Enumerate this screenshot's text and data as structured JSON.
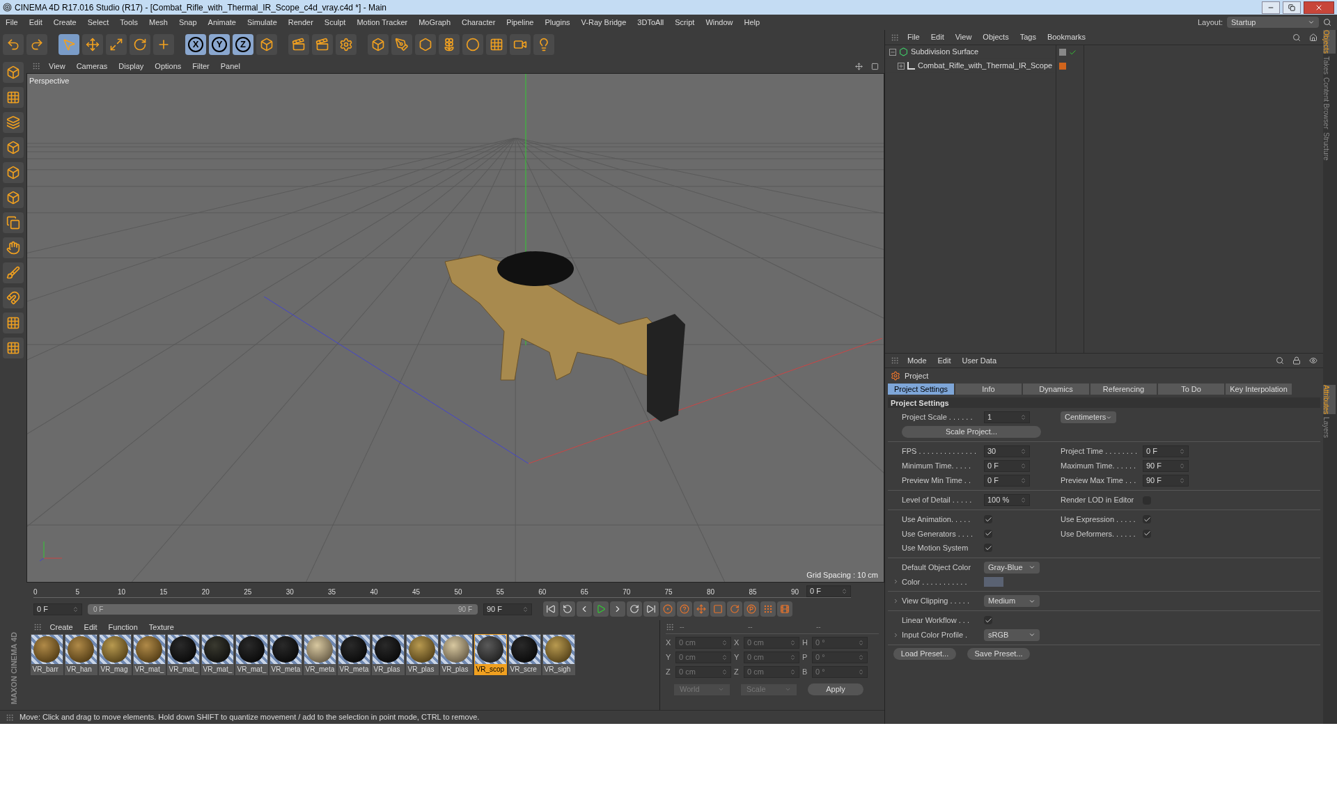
{
  "window": {
    "title": "CINEMA 4D R17.016 Studio (R17) - [Combat_Rifle_with_Thermal_IR_Scope_c4d_vray.c4d *] - Main"
  },
  "menu": [
    "File",
    "Edit",
    "Create",
    "Select",
    "Tools",
    "Mesh",
    "Snap",
    "Animate",
    "Simulate",
    "Render",
    "Sculpt",
    "Motion Tracker",
    "MoGraph",
    "Character",
    "Pipeline",
    "Plugins",
    "V-Ray Bridge",
    "3DToAll",
    "Script",
    "Window",
    "Help"
  ],
  "layout": {
    "label": "Layout:",
    "value": "Startup"
  },
  "toolbar": {
    "axis_locks": [
      "X",
      "Y",
      "Z"
    ]
  },
  "viewport": {
    "menu": [
      "View",
      "Cameras",
      "Display",
      "Options",
      "Filter",
      "Panel"
    ],
    "camera": "Perspective",
    "grid_spacing": "Grid Spacing : 10 cm"
  },
  "brand": "MAXON CINEMA 4D",
  "timeline": {
    "level": 1,
    "ticks": [
      "0",
      "5",
      "10",
      "15",
      "20",
      "25",
      "30",
      "35",
      "40",
      "45",
      "50",
      "55",
      "60",
      "65",
      "70",
      "75",
      "80",
      "85",
      "90"
    ],
    "current": "0 F",
    "start": "0 F",
    "range_start": "0 F",
    "range_end": "90 F",
    "end": "90 F"
  },
  "materials": {
    "menu": [
      "Create",
      "Edit",
      "Function",
      "Texture"
    ],
    "items": [
      {
        "label": "VR_barr",
        "kind": "worn",
        "selected": false
      },
      {
        "label": "VR_han",
        "kind": "worn",
        "selected": false
      },
      {
        "label": "VR_mag",
        "kind": "tan",
        "selected": false
      },
      {
        "label": "VR_mat_",
        "kind": "worn",
        "selected": false
      },
      {
        "label": "VR_mat_",
        "kind": "black",
        "selected": false
      },
      {
        "label": "VR_mat_",
        "kind": "dark",
        "selected": false
      },
      {
        "label": "VR_mat_",
        "kind": "black",
        "selected": false
      },
      {
        "label": "VR_meta",
        "kind": "black",
        "selected": false
      },
      {
        "label": "VR_meta",
        "kind": "pale",
        "selected": false
      },
      {
        "label": "VR_meta",
        "kind": "black",
        "selected": false
      },
      {
        "label": "VR_plas",
        "kind": "black",
        "selected": false
      },
      {
        "label": "VR_plas",
        "kind": "tan",
        "selected": false
      },
      {
        "label": "VR_plas",
        "kind": "pale",
        "selected": false
      },
      {
        "label": "VR_scop",
        "kind": "rough",
        "selected": true
      },
      {
        "label": "VR_scre",
        "kind": "black",
        "selected": false
      },
      {
        "label": "VR_sigh",
        "kind": "tan",
        "selected": false
      }
    ]
  },
  "coordinates": {
    "headers": [
      "--",
      "--",
      "--"
    ],
    "rows": [
      [
        "X",
        "0 cm",
        "X",
        "0 cm",
        "H",
        "0 °"
      ],
      [
        "Y",
        "0 cm",
        "Y",
        "0 cm",
        "P",
        "0 °"
      ],
      [
        "Z",
        "0 cm",
        "Z",
        "0 cm",
        "B",
        "0 °"
      ]
    ],
    "space": "World",
    "mode": "Scale",
    "apply": "Apply"
  },
  "status_bar": "Move: Click and drag to move elements. Hold down SHIFT to quantize movement / add to the selection in point mode, CTRL to remove.",
  "objects": {
    "menu": [
      "File",
      "Edit",
      "View",
      "Objects",
      "Tags",
      "Bookmarks"
    ],
    "items": [
      {
        "label": "Subdivision Surface",
        "expanded": true,
        "children": [
          {
            "label": "Combat_Rifle_with_Thermal_IR_Scope",
            "expanded": false
          }
        ]
      }
    ]
  },
  "side_tabs_top": [
    {
      "label": "Objects",
      "selected": true
    },
    {
      "label": "Takes",
      "selected": false
    },
    {
      "label": "Content Browser",
      "selected": false
    },
    {
      "label": "Structure",
      "selected": false
    }
  ],
  "side_tabs_bottom": [
    {
      "label": "Attributes",
      "selected": true
    },
    {
      "label": "Layers",
      "selected": false
    }
  ],
  "attributes": {
    "menu": [
      "Mode",
      "Edit",
      "User Data"
    ],
    "title": "Project",
    "tabs": [
      {
        "label": "Project Settings",
        "selected": true
      },
      {
        "label": "Info",
        "selected": false
      },
      {
        "label": "Dynamics",
        "selected": false
      },
      {
        "label": "Referencing",
        "selected": false
      },
      {
        "label": "To Do",
        "selected": false
      },
      {
        "label": "Key Interpolation",
        "selected": false
      }
    ],
    "section": "Project Settings",
    "groups": [
      [
        [
          {
            "kind": "number",
            "label": "Project Scale . . . . . .",
            "value": "1"
          },
          {
            "kind": "dropdown",
            "value": "Centimeters"
          }
        ],
        [
          {
            "kind": "button",
            "value": "Scale Project..."
          }
        ]
      ],
      [
        [
          {
            "kind": "number",
            "label": "FPS . . . . . . . . . . . . . .",
            "value": "30"
          },
          {
            "kind": "number",
            "label": "Project Time . . . . . . . .",
            "value": "0 F"
          }
        ],
        [
          {
            "kind": "number",
            "label": "Minimum Time. . . . .",
            "value": "0 F"
          },
          {
            "kind": "number",
            "label": "Maximum Time. . . . . .",
            "value": "90 F"
          }
        ],
        [
          {
            "kind": "number",
            "label": "Preview Min Time . .",
            "value": "0 F"
          },
          {
            "kind": "number",
            "label": "Preview Max Time . . .",
            "value": "90 F"
          }
        ]
      ],
      [
        [
          {
            "kind": "number",
            "label": "Level of Detail . . . . .",
            "value": "100 %"
          },
          {
            "kind": "checkbox",
            "label": "Render LOD in Editor",
            "checked": false
          }
        ]
      ],
      [
        [
          {
            "kind": "checkbox",
            "label": "Use Animation. . . . .",
            "checked": true
          },
          {
            "kind": "checkbox",
            "label": "Use Expression . . . . .",
            "checked": true
          }
        ],
        [
          {
            "kind": "checkbox",
            "label": "Use Generators . . . .",
            "checked": true
          },
          {
            "kind": "checkbox",
            "label": "Use Deformers. . . . . .",
            "checked": true
          }
        ],
        [
          {
            "kind": "checkbox",
            "label": "Use Motion System",
            "checked": true
          }
        ]
      ],
      [
        [
          {
            "kind": "dropdown",
            "label": "Default Object Color",
            "value": "Gray-Blue"
          }
        ],
        [
          {
            "kind": "swatch",
            "label": "Color . . . . . . . . . . .",
            "expandable": true
          }
        ]
      ],
      [
        [
          {
            "kind": "dropdown",
            "label": "View Clipping . . . . .",
            "value": "Medium",
            "expandable": true
          }
        ]
      ],
      [
        [
          {
            "kind": "checkbox",
            "label": "Linear Workflow . . .",
            "checked": true
          }
        ],
        [
          {
            "kind": "dropdown",
            "label": "Input Color Profile .",
            "value": "sRGB",
            "expandable": true
          }
        ]
      ]
    ],
    "buttons": [
      "Load Preset...",
      "Save Preset..."
    ]
  }
}
